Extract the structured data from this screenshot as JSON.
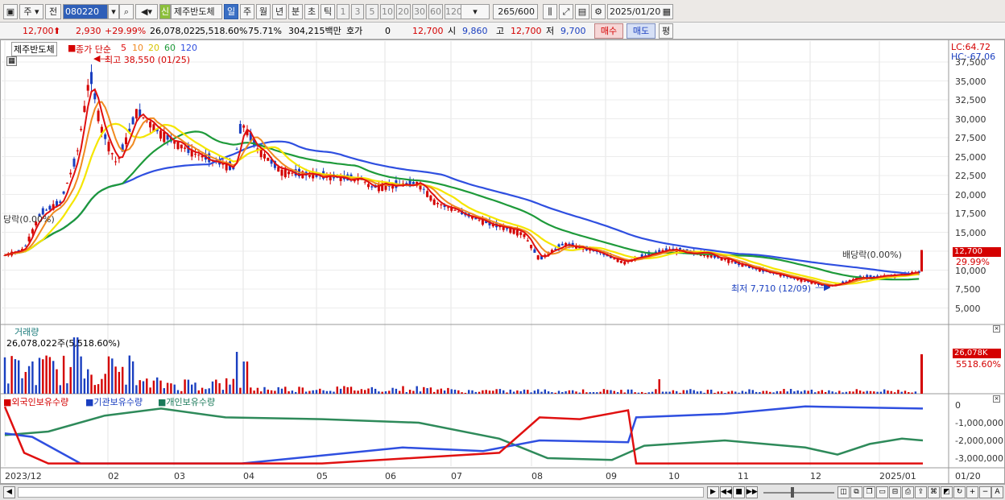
{
  "toolbar": {
    "period_type": "주",
    "prev_label": "전",
    "code": "080220",
    "company": "제주반도체",
    "new_badge": "신",
    "periods": [
      "일",
      "주",
      "월",
      "년",
      "분",
      "초",
      "틱"
    ],
    "intervals": [
      "1",
      "3",
      "5",
      "10",
      "20",
      "30",
      "60",
      "120"
    ],
    "count_label": "265",
    "count_max": "/600",
    "date": "2025/01/20"
  },
  "info": {
    "price": "12,700",
    "change": "2,930",
    "change_pct": "+29.99%",
    "volume": "26,078,022",
    "vol_ratio": "5,518.60%",
    "turnover": "75.71%",
    "amount": "304,215백만",
    "quote_label": "호가",
    "quote_value": "0",
    "quote_price": "12,700",
    "open_label": "시",
    "open": "9,860",
    "high_label": "고",
    "high": "12,700",
    "low_label": "저",
    "low": "9,700",
    "buy_button": "매수",
    "sell_button": "매도",
    "eval_button": "평"
  },
  "price_panel": {
    "legend_name": "제주반도체",
    "legend_ma": "종가 단순",
    "ma_periods": [
      "5",
      "10",
      "20",
      "60",
      "120"
    ],
    "high_note": "최고 38,550 (01/25)",
    "low_note": "최저 7,710 (12/09)",
    "div_note_left": "당락(0.00%)",
    "div_note_right": "배당락(0.00%)",
    "lc": "LC:64.72",
    "hc": "HC:-67.06",
    "price_tag": "12,700",
    "pct_tag": "29.99%",
    "yticks": [
      "37,500",
      "35,000",
      "32,500",
      "30,000",
      "27,500",
      "25,000",
      "22,500",
      "20,000",
      "17,500",
      "15,000",
      "12,500",
      "10,000",
      "7,500",
      "5,000"
    ]
  },
  "volume_panel": {
    "title": "거래량",
    "value": "26,078,022주(5,518.60%)",
    "tag": "26,078K",
    "tag_pct": "5518.60%"
  },
  "holdings_panel": {
    "series": [
      "외국인보유수량",
      "기관보유수량",
      "개인보유수량"
    ],
    "yticks": [
      "0",
      "-1,000,000",
      "-2,000,000",
      "-3,000,000"
    ]
  },
  "xaxis": [
    "2023/12",
    "02",
    "03",
    "04",
    "05",
    "06",
    "07",
    "08",
    "09",
    "10",
    "11",
    "12",
    "2025/01",
    "01/20"
  ],
  "colors": {
    "up": "#d40000",
    "down": "#1a3fc0",
    "ma5": "#e01010",
    "ma10": "#f08a20",
    "ma20": "#f5e600",
    "ma60": "#1e9a3a",
    "ma120": "#2f4fe0",
    "foreign": "#2f4fe0",
    "inst": "#e01010",
    "indiv": "#2e8a5a"
  }
}
